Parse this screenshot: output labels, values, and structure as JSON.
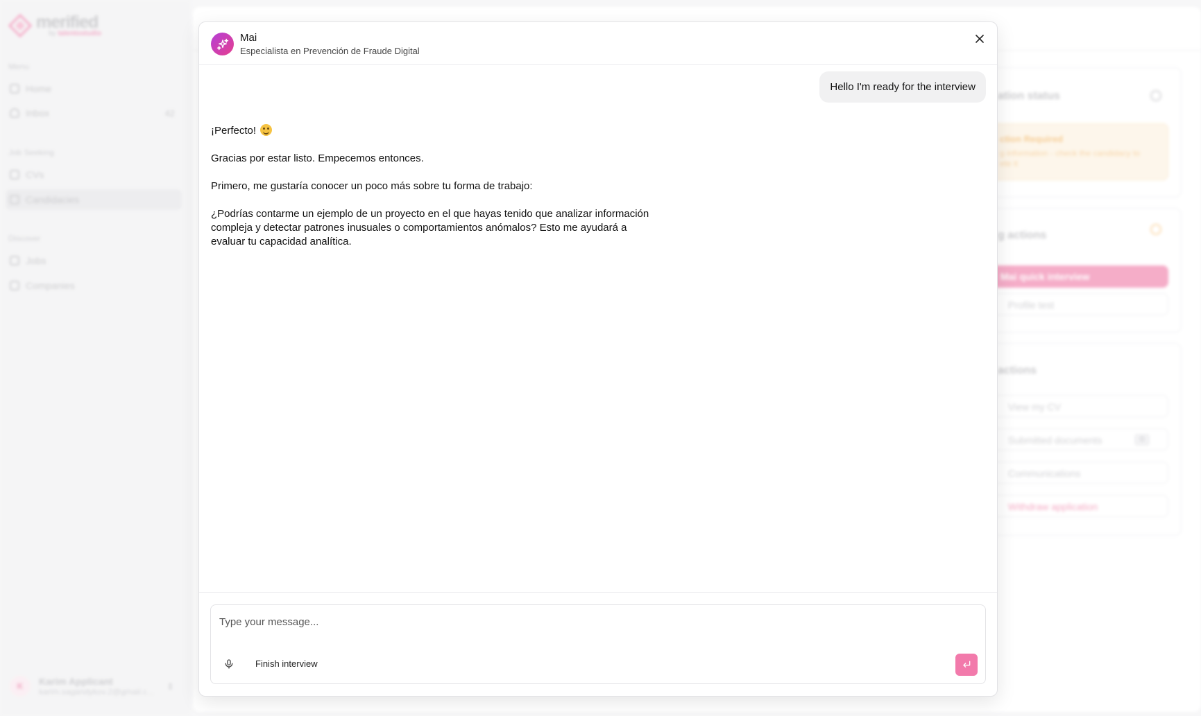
{
  "app": {
    "logo_text": "merified",
    "logo_sub_prefix": "by",
    "logo_sub_brand": "talentostudio",
    "brand_color": "#f27aab"
  },
  "sidebar": {
    "menu_label": "Menu",
    "items_menu": [
      {
        "label": "Home",
        "icon": "home-icon"
      },
      {
        "label": "Inbox",
        "icon": "bell-icon",
        "badge": "42"
      }
    ],
    "job_seeking_label": "Job Seeking",
    "items_job": [
      {
        "label": "CVs",
        "icon": "document-icon"
      },
      {
        "label": "Candidacies",
        "icon": "briefcase-icon",
        "active": true
      }
    ],
    "discover_label": "Discover",
    "items_discover": [
      {
        "label": "Jobs",
        "icon": "briefcase-icon"
      },
      {
        "label": "Companies",
        "icon": "building-icon"
      }
    ],
    "user": {
      "initial": "K",
      "name": "Karim Applicant",
      "email": "karim.sagandykov.2@gmail.c..."
    }
  },
  "background_panel": {
    "status_card": {
      "title": "ation status",
      "alert_title": "ction Required",
      "alert_text": "g information - check the candidacy to",
      "alert_text_2": "ete it"
    },
    "pending_card": {
      "title": "g actions",
      "primary_button": "Mai quick interview",
      "secondary_button": "Profile test"
    },
    "actions_card": {
      "title": "actions",
      "items": [
        "View my CV",
        "Submitted documents",
        "Communications",
        "Withdraw application"
      ],
      "documents_count": "0"
    }
  },
  "chat": {
    "bot_name": "Mai",
    "bot_role": "Especialista en Prevención de Fraude Digital",
    "bot_avatar_icon": "sparkles-icon",
    "user_message": "Hello I'm ready for the interview",
    "bot_message": {
      "line1": "¡Perfecto!",
      "line1_emoji": "smiling-face-emoji",
      "line2": "Gracias por estar listo. Empecemos entonces.",
      "line3": "Primero, me gustaría conocer un poco más sobre tu forma de trabajo:",
      "line4": "¿Podrías contarme un ejemplo de un proyecto en el que hayas tenido que analizar información compleja y detectar patrones inusuales o comportamientos anómalos? Esto me ayudará a evaluar tu capacidad analítica."
    },
    "composer": {
      "placeholder": "Type your message...",
      "value": "",
      "finish_label": "Finish interview",
      "mic_icon": "microphone-icon",
      "send_icon": "enter-icon"
    }
  }
}
